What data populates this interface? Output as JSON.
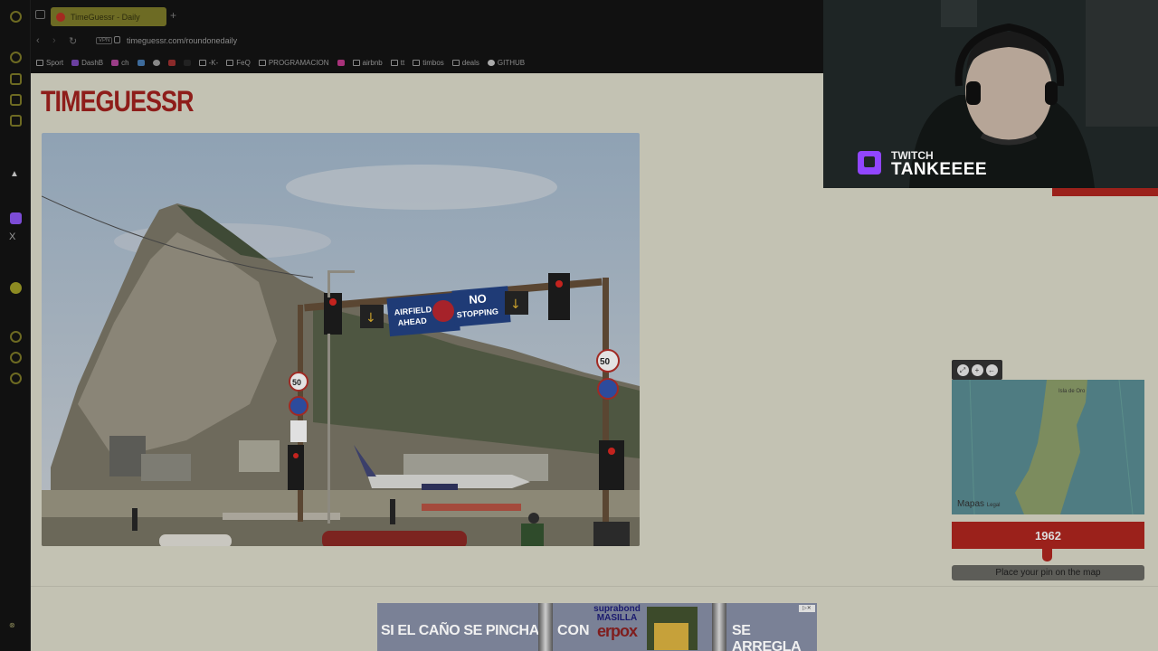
{
  "browser": {
    "tab_title": "TimeGuessr - Daily",
    "url": "timeguessr.com/roundonedaily",
    "vpn_label": "VPN",
    "bookmarks": [
      "Sport",
      "DashB",
      "ch",
      "-K-",
      "FeQ",
      "PROGRAMACION",
      "airbnb",
      "tt",
      "timbos",
      "deals",
      "GITHUB"
    ]
  },
  "page": {
    "logo_text": "TIMEGUESSR",
    "photo": {
      "sign_left_line1": "AIRFIELD",
      "sign_left_line2": "AHEAD",
      "sign_right_line1": "NO",
      "sign_right_line2": "STOPPING",
      "speed_limit_left": "50",
      "speed_limit_right": "50"
    },
    "map": {
      "label_town": "Isla de Oro",
      "credit": "Mapas",
      "credit_small": "Legal"
    },
    "year_value": "1962",
    "place_pin_label": "Place your pin on the map"
  },
  "ad": {
    "text_left": "SI EL CAÑO SE PINCHA",
    "text_mid": "CON",
    "brand_line1": "suprabond",
    "brand_line2": "MASILLA",
    "brand_line3": "erpox",
    "text_right": "SE ARREGLA"
  },
  "stream": {
    "platform": "TWITCH",
    "channel": "TANKEEEE"
  },
  "colors": {
    "brand_red": "#9b211b",
    "page_bg": "#c3c2b3",
    "twitch_purple": "#9146ff"
  }
}
